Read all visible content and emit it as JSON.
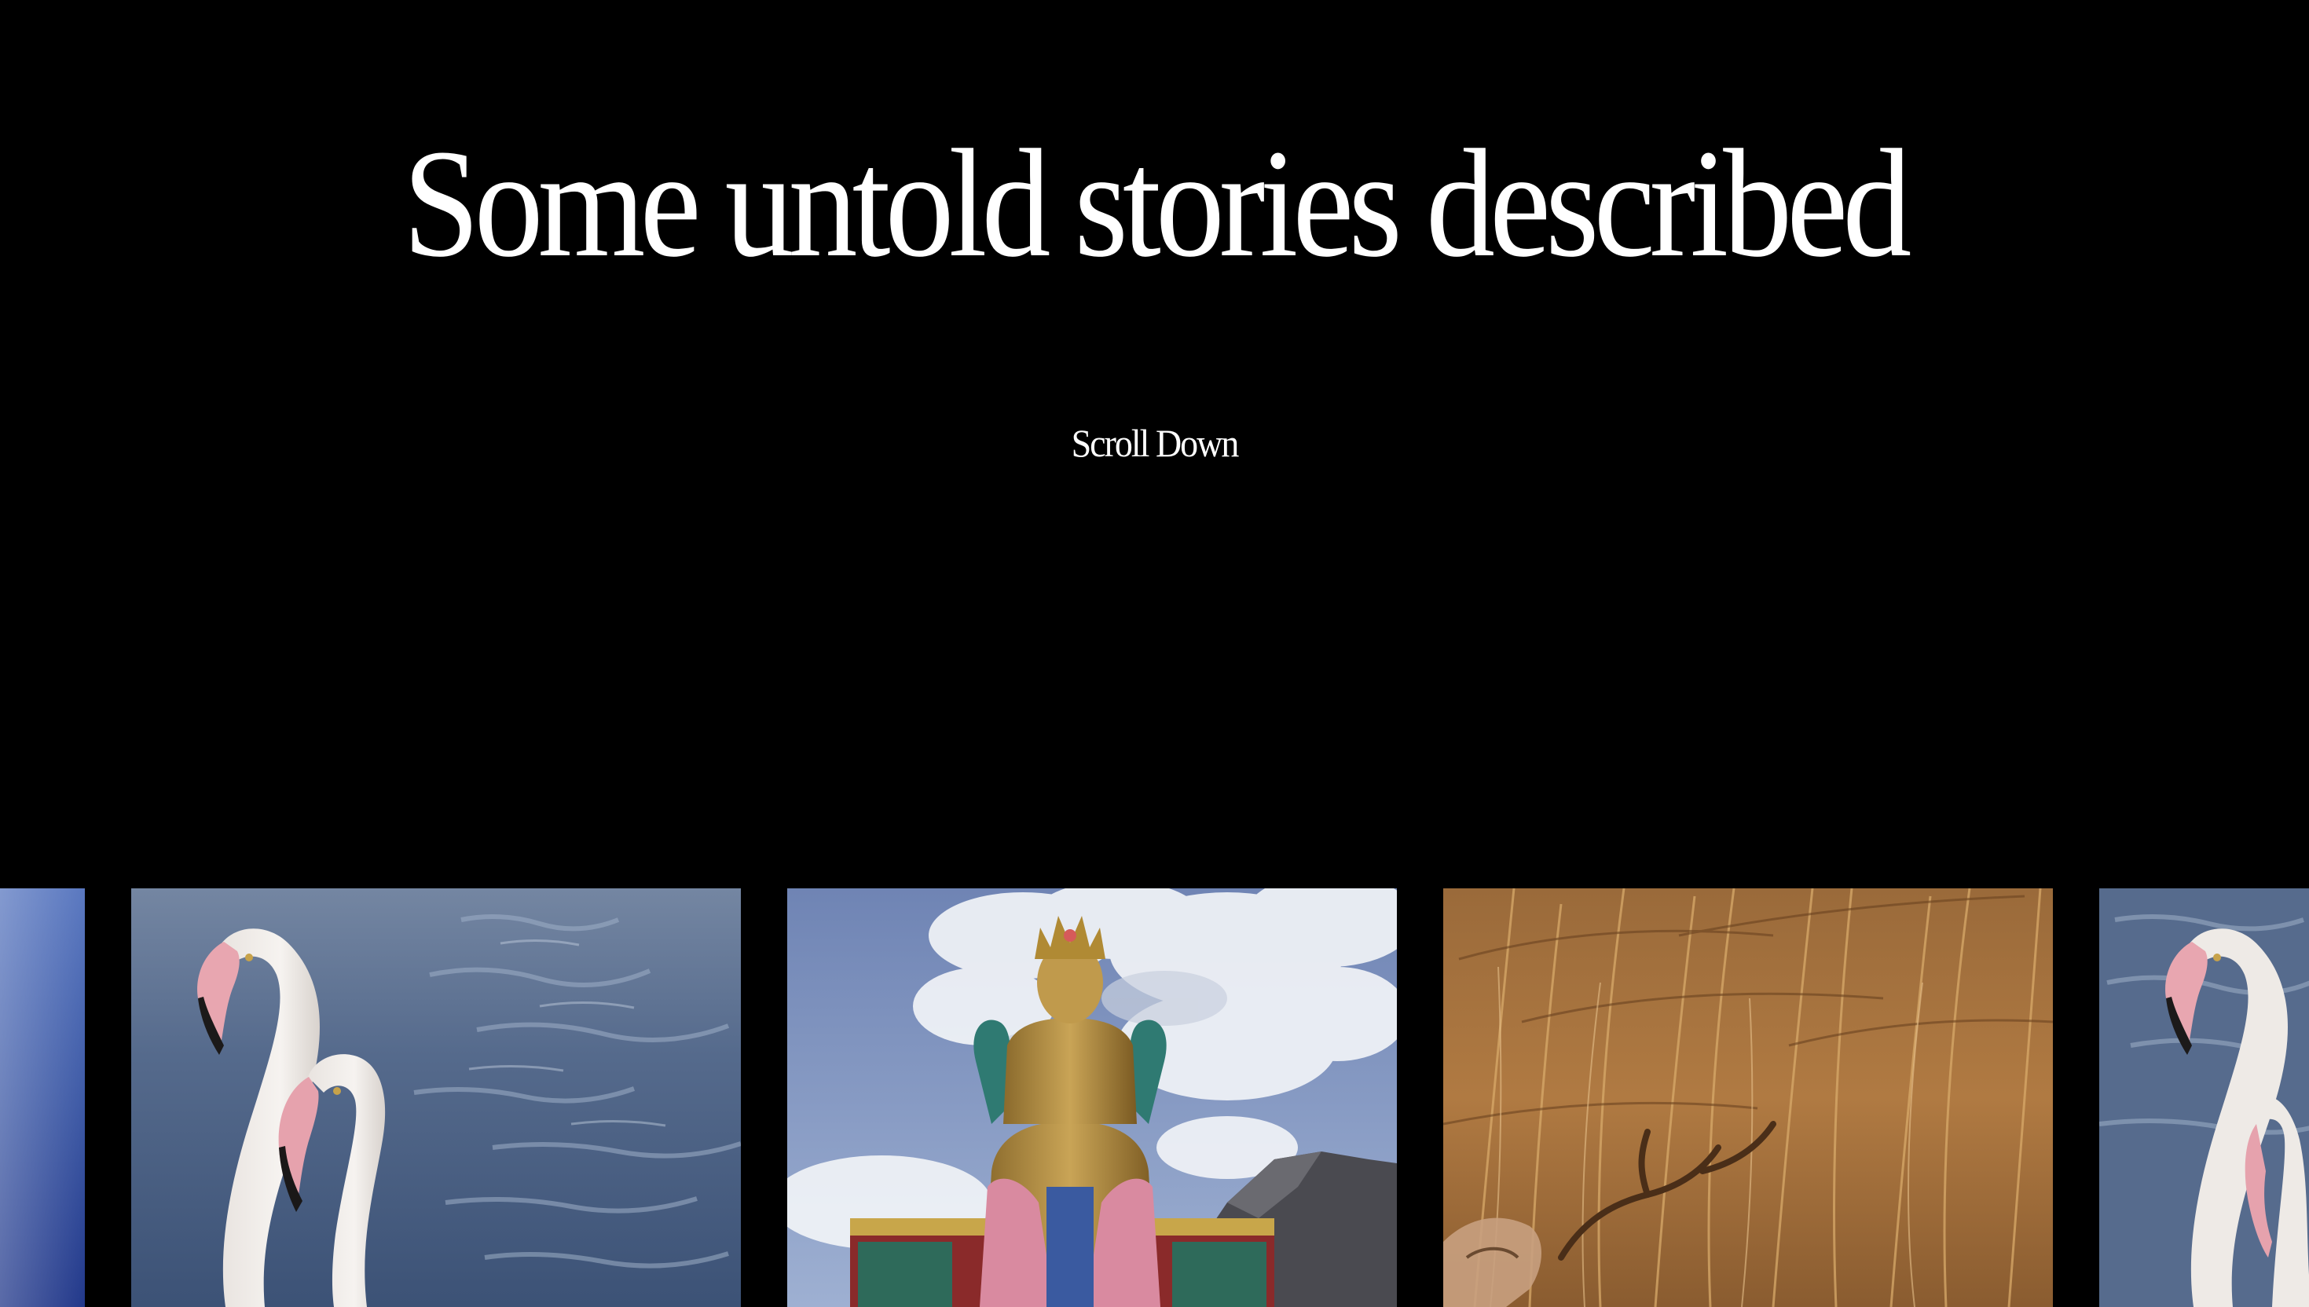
{
  "hero": {
    "title": "Some untold stories described",
    "scroll_label": "Scroll Down"
  },
  "gallery": {
    "items": [
      {
        "subject": "sky-partial"
      },
      {
        "subject": "flamingos"
      },
      {
        "subject": "buddha-statue"
      },
      {
        "subject": "deer-in-grass"
      },
      {
        "subject": "flamingos"
      }
    ]
  },
  "colors": {
    "background": "#000000",
    "text": "#ffffff"
  }
}
